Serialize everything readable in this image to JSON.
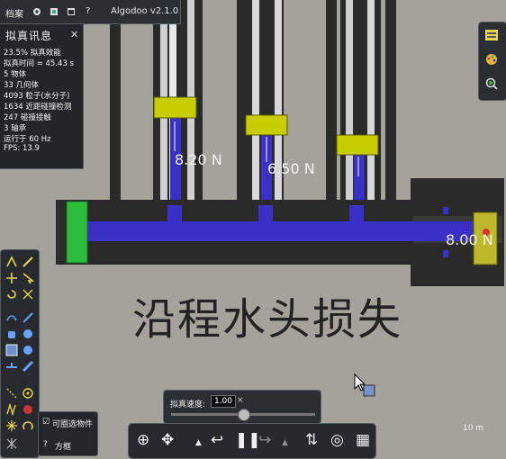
{
  "menu": {
    "file": "档案",
    "version": "Algodoo v2.1.0"
  },
  "sim_info": {
    "title": "拟真讯息",
    "close": "✕",
    "lines": [
      "23.5%  拟真效能",
      "拟真时间 = 45.43 s",
      "5 物体",
      "33 几何体",
      "4093 粒子(水分子)",
      "1634 近距碰撞检测",
      "247 碰撞接触",
      "3 轴承",
      "运行于 60 Hz",
      "FPS: 13.9"
    ]
  },
  "scene": {
    "title": "沿程水头损失",
    "forces": [
      "8.20 N",
      "6.50 N",
      "8.00 N"
    ],
    "scale_label": "10 m"
  },
  "options": {
    "checkbox_label": "可圈选物件",
    "help_label": "方框",
    "help_mark": "?"
  },
  "speed": {
    "label": "拟真速度:",
    "value": "1.00",
    "clear": "×",
    "level": 0.5
  },
  "colors": {
    "water": "#3a2fc6",
    "wall": "#2a2a2a",
    "plate": "#c8cd00",
    "green": "#2ebd3b",
    "bg": "#a3a29b"
  }
}
